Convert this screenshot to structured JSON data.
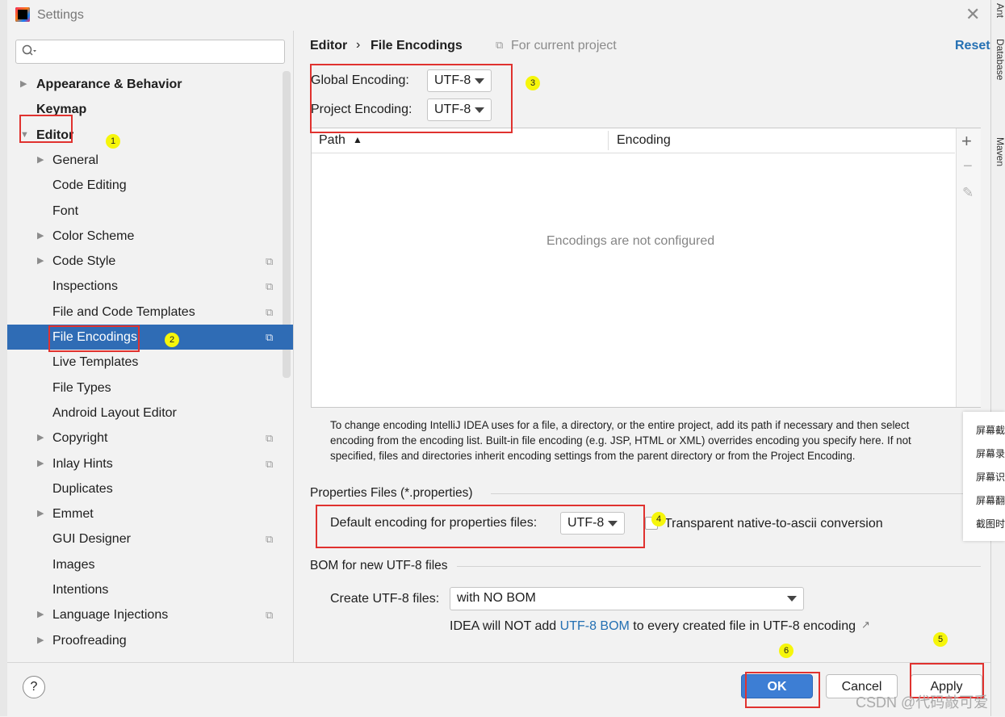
{
  "window": {
    "title": "Settings",
    "close_symbol": "✕"
  },
  "search": {
    "placeholder": "",
    "icon": "search-icon"
  },
  "sidebar": {
    "items": [
      {
        "label": "Appearance & Behavior",
        "bold": true,
        "arrow": "▶"
      },
      {
        "label": "Keymap",
        "bold": true
      },
      {
        "label": "Editor",
        "bold": true,
        "arrow": "▼"
      },
      {
        "label": "General",
        "arrow": "▶"
      },
      {
        "label": "Code Editing"
      },
      {
        "label": "Font"
      },
      {
        "label": "Color Scheme",
        "arrow": "▶"
      },
      {
        "label": "Code Style",
        "arrow": "▶",
        "project_icon": true
      },
      {
        "label": "Inspections",
        "project_icon": true
      },
      {
        "label": "File and Code Templates",
        "project_icon": true
      },
      {
        "label": "File Encodings",
        "project_icon": true,
        "selected": true
      },
      {
        "label": "Live Templates"
      },
      {
        "label": "File Types"
      },
      {
        "label": "Android Layout Editor"
      },
      {
        "label": "Copyright",
        "arrow": "▶",
        "project_icon": true
      },
      {
        "label": "Inlay Hints",
        "arrow": "▶",
        "project_icon": true
      },
      {
        "label": "Duplicates"
      },
      {
        "label": "Emmet",
        "arrow": "▶"
      },
      {
        "label": "GUI Designer",
        "project_icon": true
      },
      {
        "label": "Images"
      },
      {
        "label": "Intentions"
      },
      {
        "label": "Language Injections",
        "arrow": "▶",
        "project_icon": true
      },
      {
        "label": "Proofreading",
        "arrow": "▶"
      }
    ]
  },
  "header": {
    "breadcrumb_parent": "Editor",
    "breadcrumb_sep": "›",
    "breadcrumb_page": "File Encodings",
    "scope": "For current project",
    "reset": "Reset"
  },
  "encodings": {
    "global_label": "Global Encoding:",
    "global_value": "UTF-8",
    "project_label": "Project Encoding:",
    "project_value": "UTF-8"
  },
  "table": {
    "columns": [
      "Path",
      "Encoding"
    ],
    "sort_indicator": "▲",
    "empty_text": "Encodings are not configured",
    "tools": {
      "add": "+",
      "remove": "−",
      "edit": "✎"
    }
  },
  "help_text": "To change encoding IntelliJ IDEA uses for a file, a directory, or the entire project, add its path if necessary and then select encoding from the encoding list. Built-in file encoding (e.g. JSP, HTML or XML) overrides encoding you specify here. If not specified, files and directories inherit encoding settings from the parent directory or from the Project Encoding.",
  "properties": {
    "section_title": "Properties Files (*.properties)",
    "default_label": "Default encoding for properties files:",
    "default_value": "UTF-8",
    "transparent_label": "Transparent native-to-ascii conversion",
    "transparent_checked": false
  },
  "bom": {
    "section_title": "BOM for new UTF-8 files",
    "create_label": "Create UTF-8 files:",
    "create_value": "with NO BOM",
    "info_prefix": "IDEA will NOT add ",
    "info_link": "UTF-8 BOM",
    "info_suffix": " to every created file in UTF-8 encoding",
    "ext_symbol": "↗"
  },
  "buttons": {
    "help": "?",
    "ok": "OK",
    "cancel": "Cancel",
    "apply": "Apply"
  },
  "annotations": {
    "m1": "1",
    "m2": "2",
    "m3": "3",
    "m4": "4",
    "m5": "5",
    "m6": "6"
  },
  "side_tabs": {
    "ant": "Ant",
    "database": "Database",
    "maven": "Maven"
  },
  "popup": {
    "items": [
      "屏幕截",
      "屏幕录",
      "屏幕识",
      "屏幕翻",
      "截图时"
    ]
  },
  "watermark": "CSDN @代码敲可爱",
  "colors": {
    "selection": "#2f6cb5",
    "accent": "#2470b3",
    "ok_button": "#3d7ed4",
    "annotation_red": "#e0322f",
    "marker_yellow": "#f6f60b"
  }
}
